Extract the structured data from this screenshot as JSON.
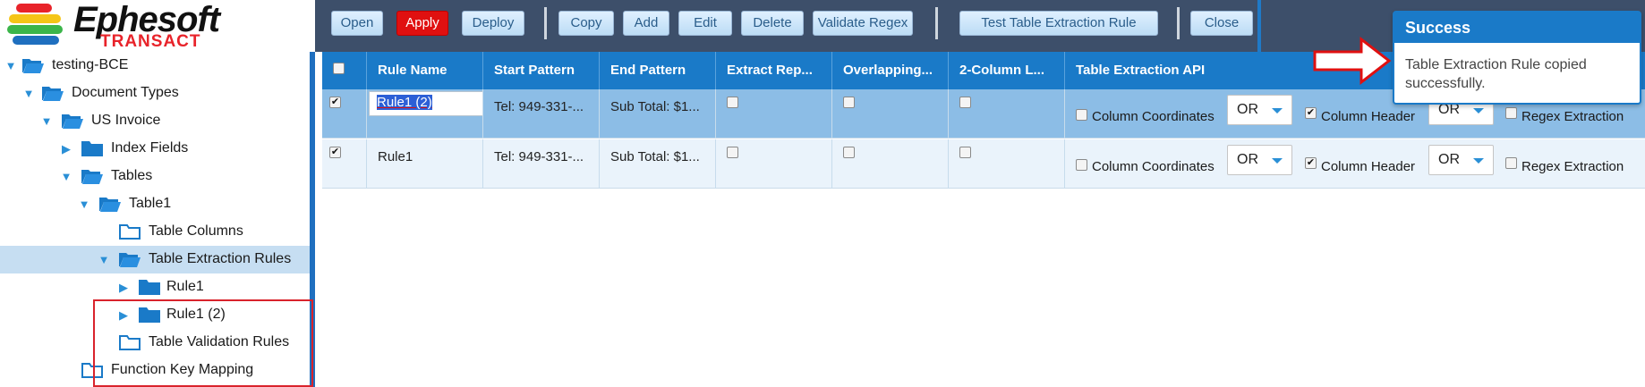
{
  "brand": {
    "name": "Ephesoft",
    "sub": "TRANSACT",
    "colors": {
      "red": "#e8232a",
      "yellow": "#f5c518",
      "green": "#3bb54a",
      "blue": "#1f6fbf"
    }
  },
  "toolbar": {
    "buttons": [
      {
        "id": "open",
        "label": "Open"
      },
      {
        "id": "apply",
        "label": "Apply",
        "primary": true
      },
      {
        "id": "deploy",
        "label": "Deploy"
      },
      {
        "id": "copy",
        "label": "Copy"
      },
      {
        "id": "add",
        "label": "Add"
      },
      {
        "id": "edit",
        "label": "Edit"
      },
      {
        "id": "delete",
        "label": "Delete"
      },
      {
        "id": "validate",
        "label": "Validate Regex"
      },
      {
        "id": "test",
        "label": "Test Table Extraction Rule"
      },
      {
        "id": "close",
        "label": "Close"
      }
    ]
  },
  "tree": {
    "items": [
      {
        "label": "testing-BCE",
        "expanded": true,
        "icon": "folder-open-icon"
      },
      {
        "label": "Document Types",
        "expanded": true,
        "icon": "folder-open-icon"
      },
      {
        "label": "US Invoice",
        "expanded": true,
        "icon": "folder-open-icon"
      },
      {
        "label": "Index Fields",
        "expanded": false,
        "icon": "folder-icon"
      },
      {
        "label": "Tables",
        "expanded": true,
        "icon": "folder-open-icon"
      },
      {
        "label": "Table1",
        "expanded": true,
        "icon": "folder-open-icon"
      },
      {
        "label": "Table Columns",
        "icon": "folder-outline-icon"
      },
      {
        "label": "Table Extraction Rules",
        "expanded": true,
        "icon": "folder-open-icon",
        "selected": true
      },
      {
        "label": "Rule1",
        "expanded": false,
        "icon": "folder-icon"
      },
      {
        "label": "Rule1 (2)",
        "expanded": false,
        "icon": "folder-icon"
      },
      {
        "label": "Table Validation Rules",
        "icon": "folder-outline-icon"
      },
      {
        "label": "Function Key Mapping",
        "icon": "folder-outline-icon"
      }
    ]
  },
  "grid": {
    "columns": [
      {
        "id": "select",
        "label": ""
      },
      {
        "id": "rule_name",
        "label": "Rule Name"
      },
      {
        "id": "start",
        "label": "Start Pattern"
      },
      {
        "id": "end",
        "label": "End Pattern"
      },
      {
        "id": "extract_rep",
        "label": "Extract Rep..."
      },
      {
        "id": "overlap",
        "label": "Overlapping..."
      },
      {
        "id": "two_col",
        "label": "2-Column L..."
      },
      {
        "id": "api",
        "label": "Table Extraction API"
      }
    ],
    "rows": [
      {
        "checked": true,
        "rule_name": "Rule1 (2)",
        "editing": true,
        "start": "Tel: 949-331-...",
        "end": "Sub Total: $1...",
        "extract_rep": false,
        "overlap": false,
        "two_col": false,
        "api": {
          "column_coordinates_label": "Column Coordinates",
          "column_coordinates": false,
          "op1": "OR",
          "column_header_label": "Column Header",
          "column_header": true,
          "op2": "OR",
          "regex_extraction_label": "Regex Extraction",
          "regex_extraction": false
        }
      },
      {
        "checked": true,
        "rule_name": "Rule1",
        "editing": false,
        "start": "Tel: 949-331-...",
        "end": "Sub Total: $1...",
        "extract_rep": false,
        "overlap": false,
        "two_col": false,
        "api": {
          "column_coordinates_label": "Column Coordinates",
          "column_coordinates": false,
          "op1": "OR",
          "column_header_label": "Column Header",
          "column_header": true,
          "op2": "OR",
          "regex_extraction_label": "Regex Extraction",
          "regex_extraction": false
        }
      }
    ]
  },
  "toast": {
    "title": "Success",
    "message": "Table Extraction Rule copied successfully."
  }
}
